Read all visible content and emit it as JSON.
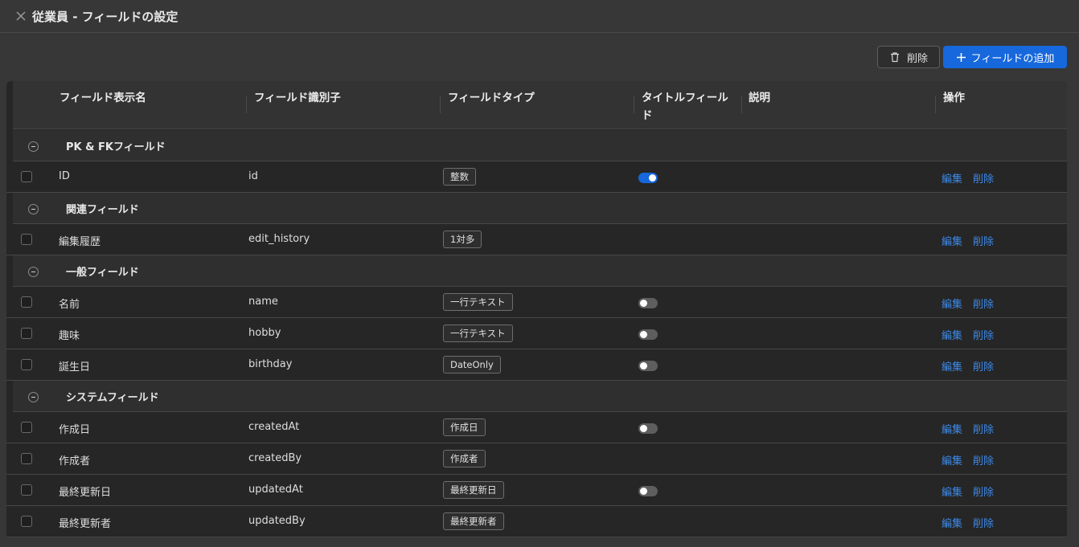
{
  "header": {
    "title": "従業員 - フィールドの設定"
  },
  "toolbar": {
    "delete_label": "削除",
    "add_label": "フィールドの追加"
  },
  "table": {
    "columns": {
      "display_name": "フィールド表示名",
      "identifier": "フィールド識別子",
      "type": "フィールドタイプ",
      "title_field_1": "タイトルフィール",
      "title_field_2": "ド",
      "description": "説明",
      "actions": "操作"
    },
    "groups": [
      {
        "label": "PK & FKフィールド",
        "rows": [
          {
            "name": "ID",
            "identifier": "id",
            "type": "整数",
            "toggle": "on"
          }
        ]
      },
      {
        "label": "関連フィールド",
        "rows": [
          {
            "name": "編集履歴",
            "identifier": "edit_history",
            "type": "1対多",
            "toggle": "none"
          }
        ]
      },
      {
        "label": "一般フィールド",
        "rows": [
          {
            "name": "名前",
            "identifier": "name",
            "type": "一行テキスト",
            "toggle": "off"
          },
          {
            "name": "趣味",
            "identifier": "hobby",
            "type": "一行テキスト",
            "toggle": "off"
          },
          {
            "name": "誕生日",
            "identifier": "birthday",
            "type": "DateOnly",
            "toggle": "off"
          }
        ]
      },
      {
        "label": "システムフィールド",
        "rows": [
          {
            "name": "作成日",
            "identifier": "createdAt",
            "type": "作成日",
            "toggle": "off"
          },
          {
            "name": "作成者",
            "identifier": "createdBy",
            "type": "作成者",
            "toggle": "none"
          },
          {
            "name": "最終更新日",
            "identifier": "updatedAt",
            "type": "最終更新日",
            "toggle": "off"
          },
          {
            "name": "最終更新者",
            "identifier": "updatedBy",
            "type": "最終更新者",
            "toggle": "none"
          }
        ]
      }
    ],
    "edit_label": "編集",
    "delete_label": "削除"
  },
  "colors": {
    "accent": "#1668dc",
    "link": "#3c89e8",
    "background": "#373737"
  }
}
